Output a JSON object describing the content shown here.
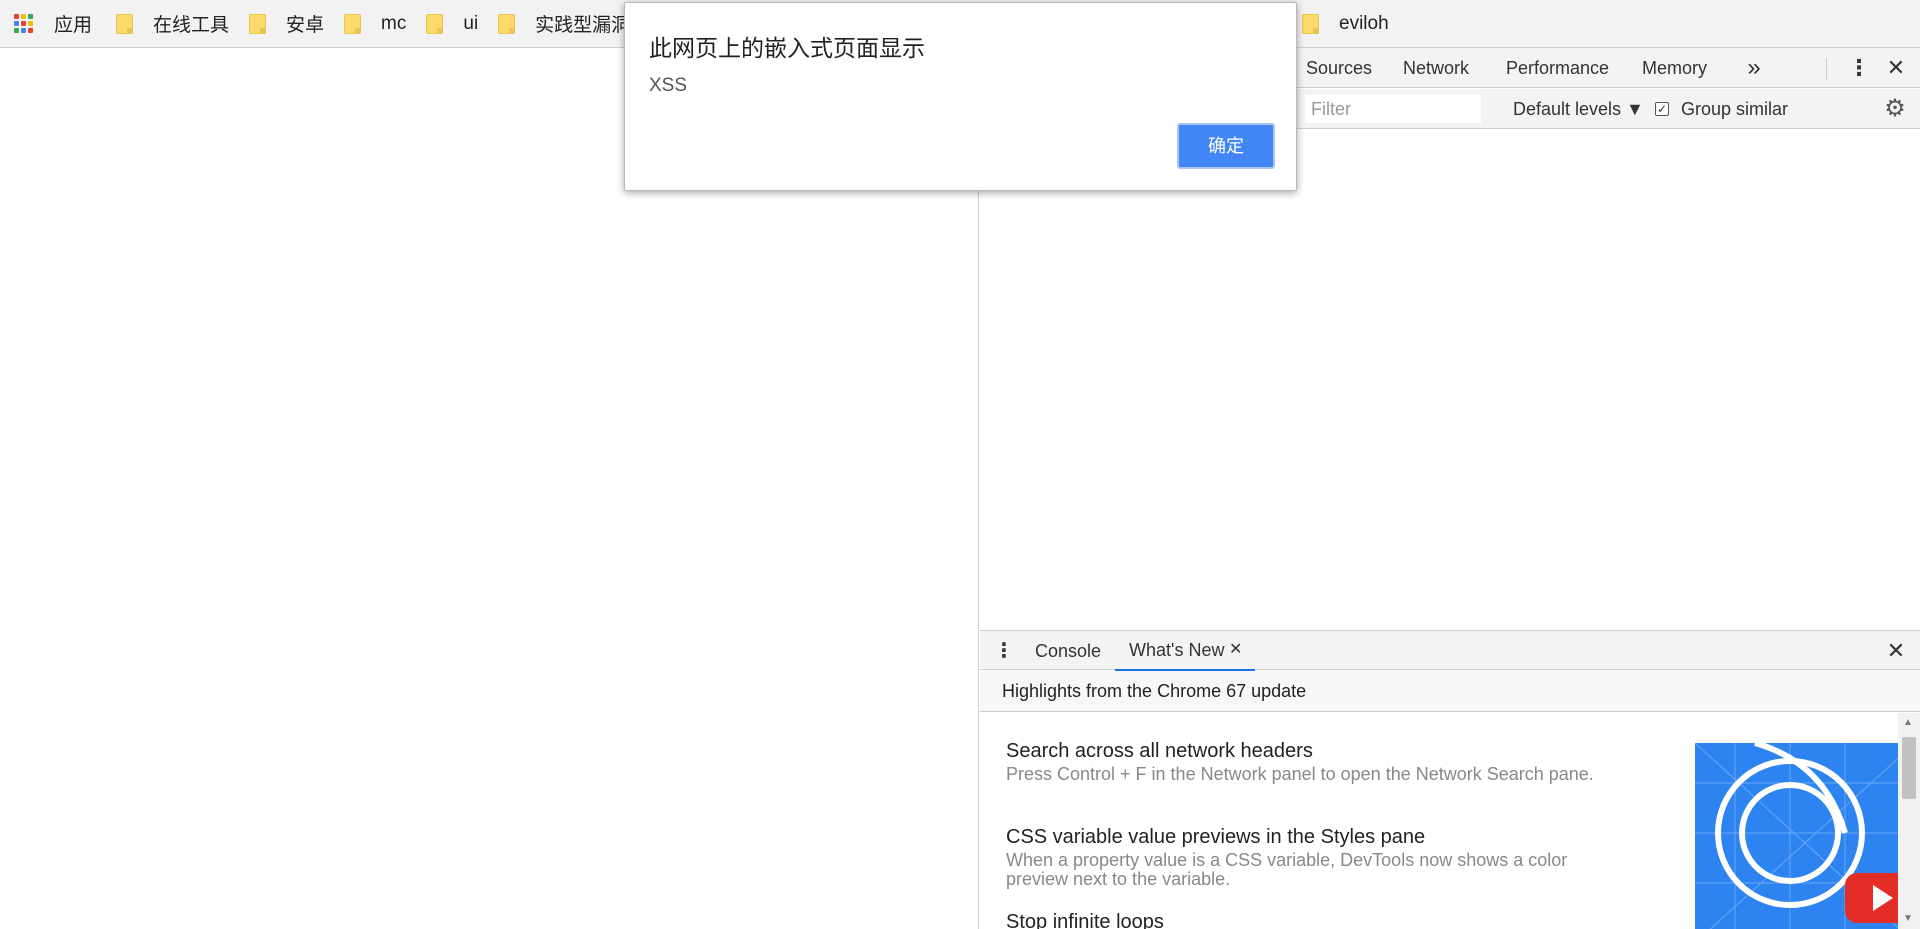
{
  "bookmarks": {
    "apps_label": "应用",
    "items": [
      "在线工具",
      "安卓",
      "mc",
      "ui",
      "实践型漏洞",
      "eviloh"
    ]
  },
  "devtools": {
    "tabs": [
      "Sources",
      "Network",
      "Performance",
      "Memory"
    ],
    "more_icon": "double-chevron-icon",
    "toolbar": {
      "filter_placeholder": "Filter",
      "levels": "Default levels ▼",
      "group_similar": "Group similar",
      "group_similar_checked": true
    },
    "drawer": {
      "tabs": [
        "Console",
        "What's New"
      ],
      "active_tab": "What's New",
      "header": "Highlights from the Chrome 67 update",
      "features": [
        {
          "title": "Search across all network headers",
          "desc": "Press Control + F in the Network panel to open the Network Search pane."
        },
        {
          "title": "CSS variable value previews in the Styles pane",
          "desc": "When a property value is a CSS variable, DevTools now shows a color preview next to the variable."
        },
        {
          "title": "Stop infinite loops",
          "desc": ""
        }
      ]
    }
  },
  "alert": {
    "title": "此网页上的嵌入式页面显示",
    "message": "XSS",
    "ok_label": "确定"
  },
  "colors": {
    "accent": "#4285f4",
    "folder": "#fcd96b",
    "tab_underline": "#1a73e8",
    "promo_bg": "#2d83f0"
  }
}
